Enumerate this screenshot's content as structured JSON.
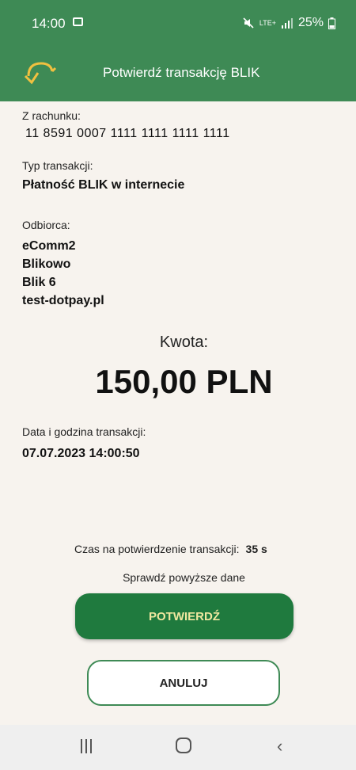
{
  "status_bar": {
    "time": "14:00",
    "signal": "LTE+",
    "battery": "25%"
  },
  "app_bar": {
    "title": "Potwierdź transakcję BLIK"
  },
  "account": {
    "label": "Z rachunku:",
    "number": "11 8591 0007 1111 1111 1111 1111"
  },
  "transaction_type": {
    "label": "Typ transakcji:",
    "value": "Płatność BLIK w internecie"
  },
  "recipient": {
    "label": "Odbiorca:",
    "lines": [
      "eComm2",
      "Blikowo",
      "Blik 6",
      "test-dotpay.pl"
    ]
  },
  "amount": {
    "label": "Kwota:",
    "value": "150,00 PLN"
  },
  "datetime": {
    "label": "Data i godzina transakcji:",
    "value": "07.07.2023 14:00:50"
  },
  "timer": {
    "label": "Czas na potwierdzenie transakcji:",
    "value": "35 s"
  },
  "check_text": "Sprawdź powyższe dane",
  "buttons": {
    "confirm": "POTWIERDŹ",
    "cancel": "ANULUJ"
  },
  "colors": {
    "header": "#3e8a55",
    "confirm_button": "#1f7a3e",
    "confirm_text": "#f0e8a0",
    "background": "#f7f3ee"
  }
}
